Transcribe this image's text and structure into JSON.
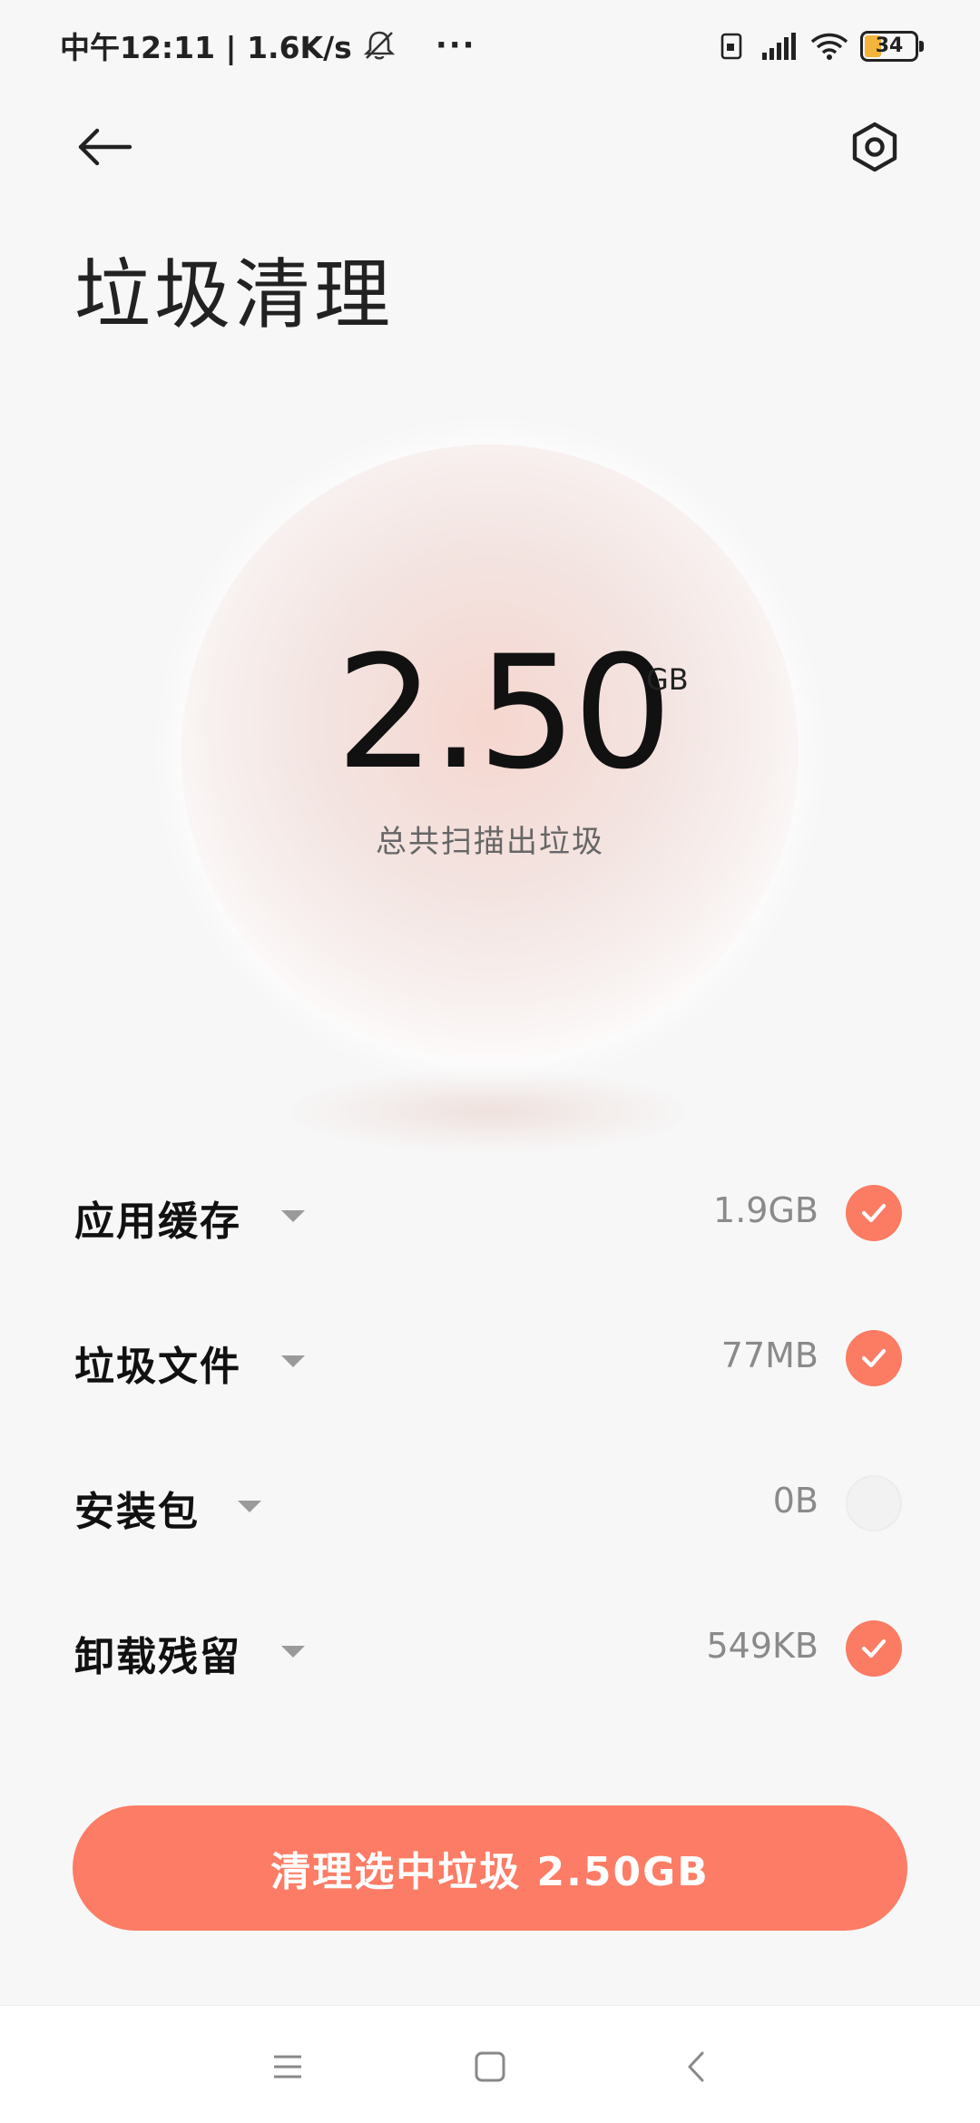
{
  "status_bar": {
    "time_speed": "中午12:11 | 1.6K/s",
    "more": "···",
    "battery": "34",
    "battery_level": 0.34
  },
  "header": {
    "title": "垃圾清理"
  },
  "summary": {
    "value": "2.50",
    "unit": "GB",
    "caption": "总共扫描出垃圾"
  },
  "items": [
    {
      "label": "应用缓存",
      "size": "1.9GB",
      "checked": true
    },
    {
      "label": "垃圾文件",
      "size": "77MB",
      "checked": true
    },
    {
      "label": "安装包",
      "size": "0B",
      "checked": false
    },
    {
      "label": "卸载残留",
      "size": "549KB",
      "checked": true
    }
  ],
  "action": {
    "clean_label": "清理选中垃圾 2.50GB"
  },
  "colors": {
    "accent": "#fc7c65",
    "background": "#f7f7f7"
  },
  "icons": [
    "back-arrow-icon",
    "settings-icon",
    "bell-off-icon",
    "signal-icon",
    "wifi-icon",
    "menu-icon",
    "home-icon",
    "back-icon"
  ]
}
